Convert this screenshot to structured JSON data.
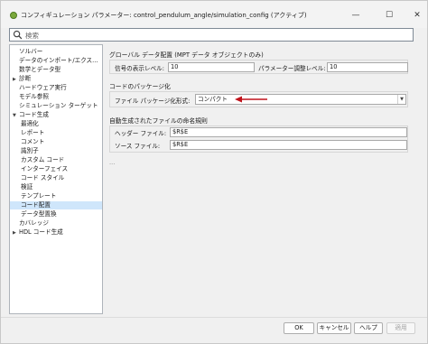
{
  "window": {
    "title": "コンフィギュレーション パラメーター: control_pendulum_angle/simulation_config (アクティブ)",
    "minimize_glyph": "—",
    "maximize_glyph": "☐",
    "close_glyph": "✕"
  },
  "search": {
    "placeholder": "検索"
  },
  "tree": {
    "items": [
      {
        "label": "ソルバー",
        "indent": 0,
        "arrow": ""
      },
      {
        "label": "データのインポート/エクス...",
        "indent": 0,
        "arrow": ""
      },
      {
        "label": "数学とデータ型",
        "indent": 0,
        "arrow": ""
      },
      {
        "label": "診断",
        "indent": 0,
        "arrow": "▶"
      },
      {
        "label": "ハードウェア実行",
        "indent": 0,
        "arrow": ""
      },
      {
        "label": "モデル参照",
        "indent": 0,
        "arrow": ""
      },
      {
        "label": "シミュレーション ターゲット",
        "indent": 0,
        "arrow": ""
      },
      {
        "label": "コード生成",
        "indent": 0,
        "arrow": "▼"
      },
      {
        "label": "最適化",
        "indent": 1,
        "arrow": ""
      },
      {
        "label": "レポート",
        "indent": 1,
        "arrow": ""
      },
      {
        "label": "コメント",
        "indent": 1,
        "arrow": ""
      },
      {
        "label": "識別子",
        "indent": 1,
        "arrow": ""
      },
      {
        "label": "カスタム コード",
        "indent": 1,
        "arrow": ""
      },
      {
        "label": "インターフェイス",
        "indent": 1,
        "arrow": ""
      },
      {
        "label": "コード スタイル",
        "indent": 1,
        "arrow": ""
      },
      {
        "label": "検証",
        "indent": 1,
        "arrow": ""
      },
      {
        "label": "テンプレート",
        "indent": 1,
        "arrow": ""
      },
      {
        "label": "コード配置",
        "indent": 1,
        "arrow": "",
        "selected": true
      },
      {
        "label": "データ型置換",
        "indent": 1,
        "arrow": ""
      },
      {
        "label": "カバレッジ",
        "indent": 0,
        "arrow": ""
      },
      {
        "label": "HDL コード生成",
        "indent": 0,
        "arrow": "▶"
      }
    ]
  },
  "global_data": {
    "title": "グローバル データ配置 (MPT データ オブジェクトのみ)",
    "signal_level_label": "信号の表示レベル:",
    "signal_level_value": "10",
    "param_level_label": "パラメーター調整レベル:",
    "param_level_value": "10"
  },
  "packaging": {
    "title": "コードのパッケージ化",
    "format_label": "ファイル パッケージ化形式:",
    "format_value": "コンパクト"
  },
  "naming": {
    "title": "自動生成されたファイルの命名規則",
    "header_label": "ヘッダー ファイル:",
    "header_value": "$R$E",
    "source_label": "ソース ファイル:",
    "source_value": "$R$E",
    "ellipsis": "..."
  },
  "buttons": {
    "ok": "OK",
    "cancel": "キャンセル",
    "help": "ヘルプ",
    "apply": "適用"
  },
  "colors": {
    "annotation_arrow": "#c0121b",
    "selection": "#cfe6fb"
  }
}
